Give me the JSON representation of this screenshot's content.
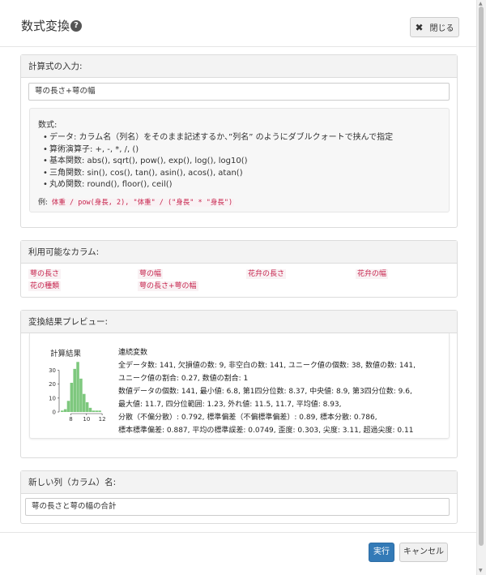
{
  "dialog": {
    "title": "数式変換",
    "close_label": "閉じる"
  },
  "formula_section": {
    "header": "計算式の入力:",
    "input_value": "萼の長さ+萼の幅",
    "help_title": "数式:",
    "help_items": [
      "データ: カラム名（列名）をそのまま記述するか、”列名” のようにダブルクォートで挟んで指定",
      "算術演算子: +, -, *, /, ()",
      "基本関数: abs(), sqrt(), pow(), exp(), log(), log10()",
      "三角関数: sin(), cos(), tan(), asin(), acos(), atan()",
      "丸め関数: round(), floor(), ceil()"
    ],
    "example_label": "例:",
    "example_code": "体重 / pow(身長, 2), \"体重\" / (\"身長\" * \"身長\")"
  },
  "columns_section": {
    "header": "利用可能なカラム:",
    "columns": [
      "萼の長さ",
      "萼の幅",
      "花弁の長さ",
      "花弁の幅",
      "花の種類",
      "萼の長さ+萼の幅"
    ]
  },
  "preview_section": {
    "header": "変換結果プレビュー:",
    "chart_title": "計算結果",
    "stats_lines": [
      "連続変数",
      "全データ数: 141, 欠損値の数: 9, 非空白の数: 141, ユニーク値の個数: 38, 数値の数: 141,",
      "ユニーク値の割合: 0.27, 数値の割合: 1",
      "数値データの個数: 141, 最小値: 6.8, 第1四分位数: 8.37, 中央値: 8.9, 第3四分位数: 9.6,",
      "最大値: 11.7, 四分位範囲: 1.23, 外れ値: 11.5, 11.7, 平均値: 8.93,",
      "分散（不偏分散）: 0.792, 標準偏差（不偏標準偏差）: 0.89, 標本分散: 0.786,",
      "標本標準偏差: 0.887, 平均の標準誤差: 0.0749, 歪度: 0.303, 尖度: 3.11, 超過尖度: 0.11"
    ]
  },
  "newcol_section": {
    "header": "新しい列（カラム）名:",
    "input_value": "萼の長さと萼の幅の合計"
  },
  "buttons": {
    "run": "実行",
    "cancel": "キャンセル"
  },
  "colors": {
    "histogram_bar": "#7ec87e",
    "primary_button": "#337ab7",
    "code_text": "#c7254e"
  },
  "chart_data": {
    "type": "bar",
    "title": "計算結果",
    "x_ticks": [
      "8",
      "10",
      "12"
    ],
    "y_ticks": [
      "0",
      "10",
      "20",
      "30"
    ],
    "ylim": [
      0,
      35
    ],
    "bins": [
      {
        "x": 6.9,
        "count": 1
      },
      {
        "x": 7.3,
        "count": 2
      },
      {
        "x": 7.7,
        "count": 8
      },
      {
        "x": 8.1,
        "count": 21
      },
      {
        "x": 8.5,
        "count": 31
      },
      {
        "x": 8.9,
        "count": 36
      },
      {
        "x": 9.3,
        "count": 24
      },
      {
        "x": 9.7,
        "count": 13
      },
      {
        "x": 10.1,
        "count": 7
      },
      {
        "x": 10.5,
        "count": 3
      },
      {
        "x": 10.9,
        "count": 1
      },
      {
        "x": 11.3,
        "count": 1
      },
      {
        "x": 11.7,
        "count": 1
      }
    ]
  }
}
